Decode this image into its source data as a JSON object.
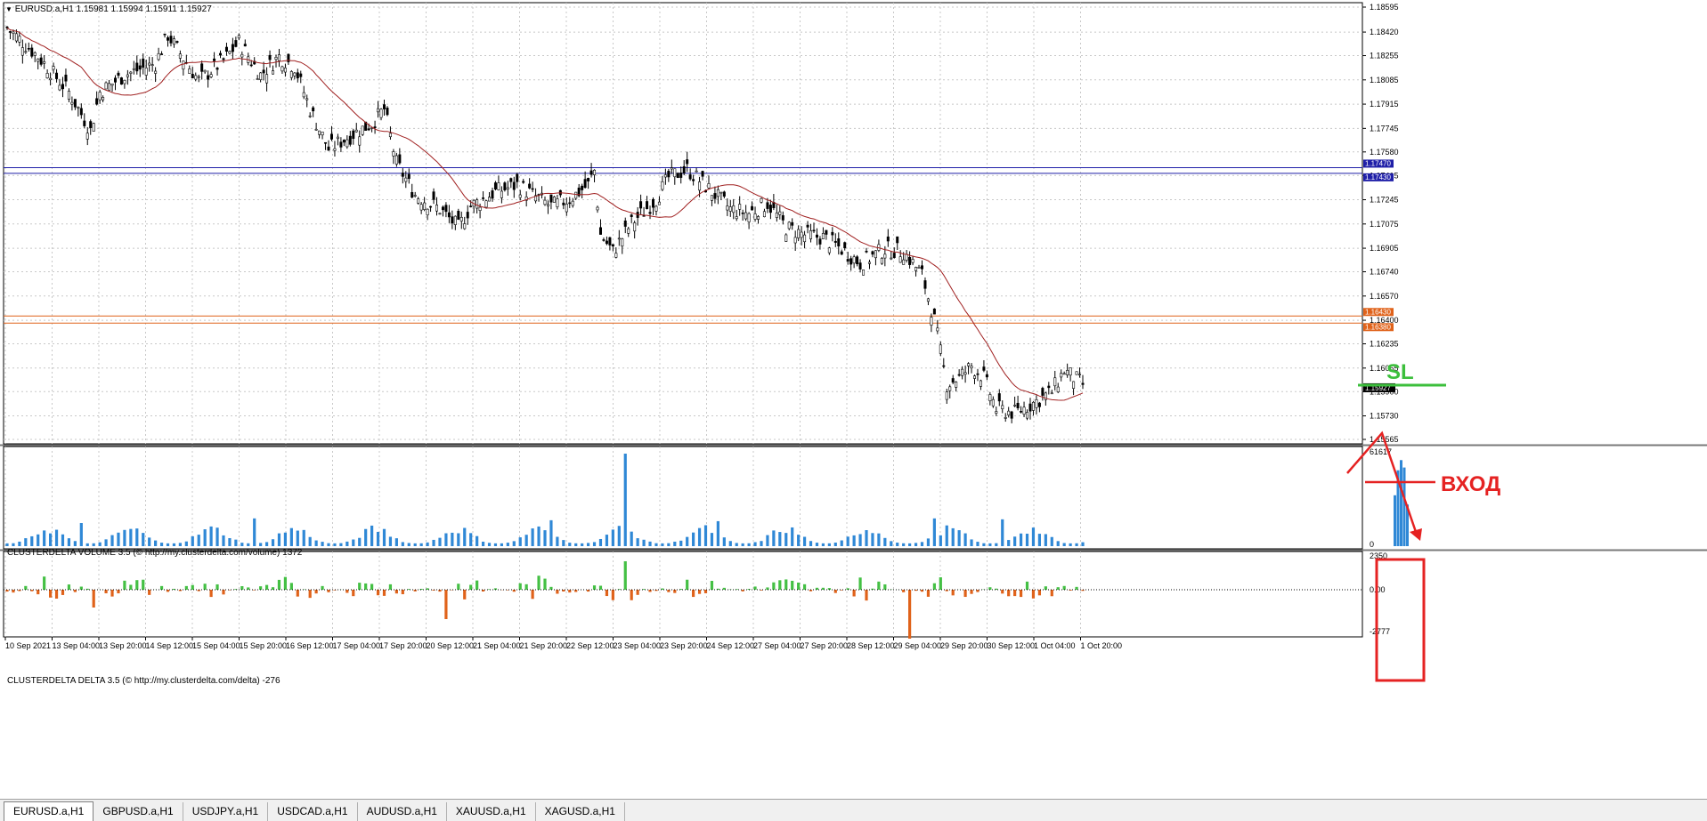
{
  "main": {
    "symbol_header": "EURUSD.a,H1  1.15981 1.15994 1.15911 1.15927",
    "price_labels": [
      "1.18595",
      "1.18420",
      "1.18255",
      "1.18085",
      "1.17915",
      "1.17745",
      "1.17580",
      "1.17415",
      "1.17245",
      "1.17075",
      "1.16905",
      "1.16740",
      "1.16570",
      "1.16400",
      "1.16235",
      "1.16065",
      "1.15900",
      "1.15730",
      "1.15565"
    ],
    "hlines": [
      {
        "price": "1.17470",
        "color": "#1f1fa8"
      },
      {
        "price": "1.17430",
        "color": "#1f1fa8"
      },
      {
        "price": "1.16430",
        "color": "#e0621a"
      },
      {
        "price": "1.16380",
        "color": "#e0621a"
      }
    ],
    "current_price": "1.15927"
  },
  "volume": {
    "header": "CLUSTERDELTA VOLUME 3.5 (© http://my.clusterdelta.com/volume) 1372",
    "max_label": "61617",
    "zero_label": "0",
    "bar_color": "#2f88d6"
  },
  "delta": {
    "header": "CLUSTERDELTA DELTA 3.5 (© http://my.clusterdelta.com/delta) -276",
    "top_label": "2350",
    "zero_label": "0.00",
    "bottom_label": "-2777",
    "pos_color": "#44c044",
    "neg_color": "#e0621a"
  },
  "annotations": {
    "sl_label": "SL",
    "entry_label": "ВХОД",
    "sl_color": "#3cbf3c",
    "entry_color": "#e52222"
  },
  "time_labels": [
    "10 Sep 2021",
    "13 Sep 04:00",
    "13 Sep 20:00",
    "14 Sep 12:00",
    "15 Sep 04:00",
    "15 Sep 20:00",
    "16 Sep 12:00",
    "17 Sep 04:00",
    "17 Sep 20:00",
    "20 Sep 12:00",
    "21 Sep 04:00",
    "21 Sep 20:00",
    "22 Sep 12:00",
    "23 Sep 04:00",
    "23 Sep 20:00",
    "24 Sep 12:00",
    "27 Sep 04:00",
    "27 Sep 20:00",
    "28 Sep 12:00",
    "29 Sep 04:00",
    "29 Sep 20:00",
    "30 Sep 12:00",
    "1 Oct 04:00",
    "1 Oct 20:00"
  ],
  "tabs": [
    "EURUSD.a,H1",
    "GBPUSD.a,H1",
    "USDJPY.a,H1",
    "USDCAD.a,H1",
    "AUDUSD.a,H1",
    "XAUUSD.a,H1",
    "XAGUSD.a,H1"
  ],
  "active_tab": 0
}
